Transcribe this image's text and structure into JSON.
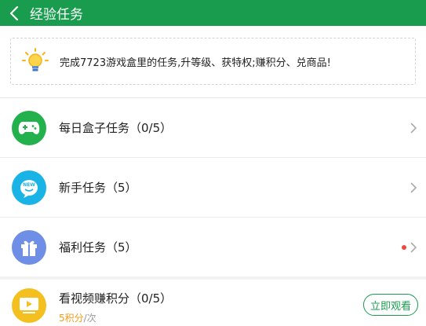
{
  "header": {
    "title": "经验任务",
    "back_icon": "chevron-left-icon"
  },
  "notice": {
    "icon": "lightbulb-icon",
    "text": "完成7723游戏盒里的任务,升等级、获特权;赚积分、兑商品!"
  },
  "tasks": [
    {
      "label": "每日盒子任务（0/5）",
      "icon": "gamepad-icon",
      "icon_color": "#22b14c",
      "has_dot": false
    },
    {
      "label": "新手任务（5）",
      "icon": "new-badge-icon",
      "icon_color": "#1ab3e6",
      "has_dot": false
    },
    {
      "label": "福利任务（5）",
      "icon": "gift-icon",
      "icon_color": "#6f8fe6",
      "has_dot": true
    }
  ],
  "video_task": {
    "title": "看视频赚积分（0/5）",
    "points": "5积分",
    "per": "/次",
    "icon": "video-play-icon",
    "icon_color": "#f4c01f",
    "button_label": "立即观看"
  },
  "colors": {
    "brand_green": "#1a9c4f",
    "dot_red": "#f0483e",
    "points_orange": "#f39b19"
  }
}
